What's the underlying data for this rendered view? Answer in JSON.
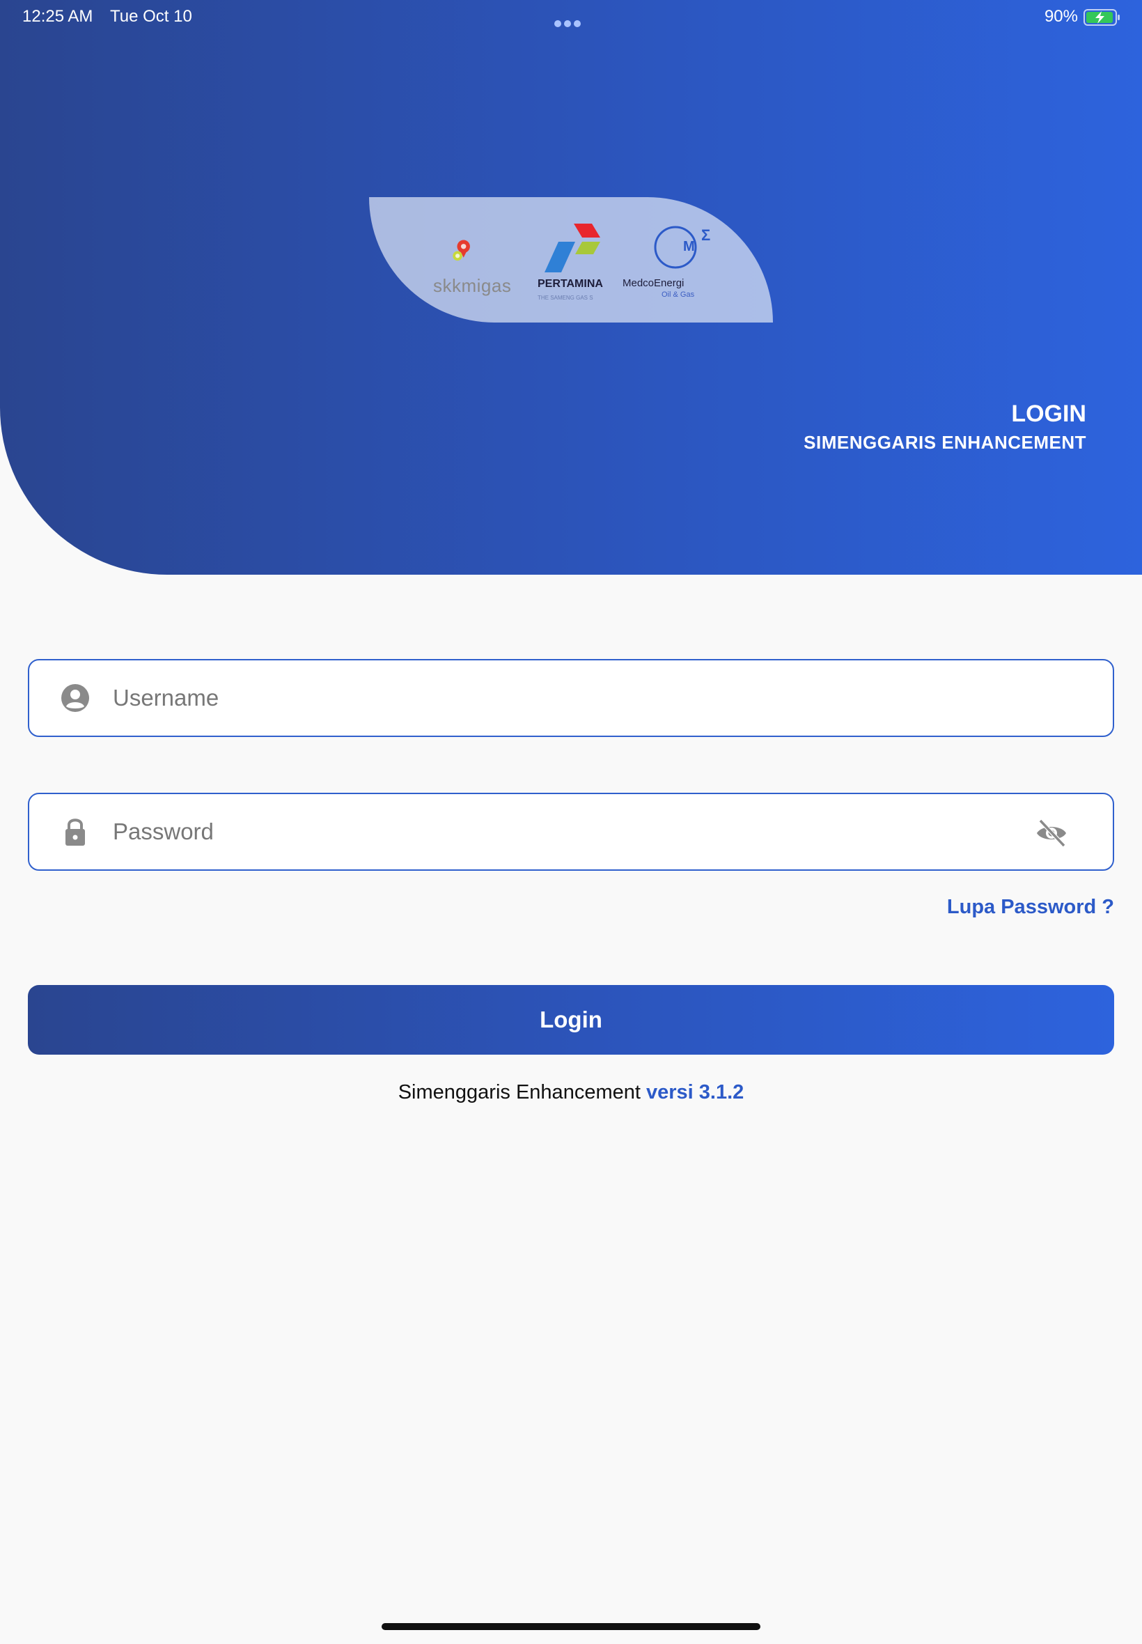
{
  "status_bar": {
    "time": "12:25 AM",
    "date": "Tue Oct 10",
    "battery_percent": "90%",
    "battery_level": 0.9
  },
  "header": {
    "title": "LOGIN",
    "subtitle": "SIMENGGARIS ENHANCEMENT"
  },
  "logos": {
    "skk_text": "skkmigas",
    "pertamina_text": "PERTAMINA",
    "pertamina_sub": "THE SAMENG GAS S",
    "medco_text": "MedcoEnergi",
    "medco_sub": "Oil & Gas",
    "medco_mark": "M",
    "medco_sigma": "Σ"
  },
  "form": {
    "username_placeholder": "Username",
    "password_placeholder": "Password",
    "forgot_password": "Lupa Password ?",
    "login_button": "Login"
  },
  "footer": {
    "app_name": "Simenggaris Enhancement",
    "version_label": "versi 3.1.2"
  },
  "colors": {
    "primary": "#2c5ac8",
    "gradient_start": "#2a4590",
    "gradient_end": "#2d63dd",
    "background": "#f9f9f9"
  }
}
